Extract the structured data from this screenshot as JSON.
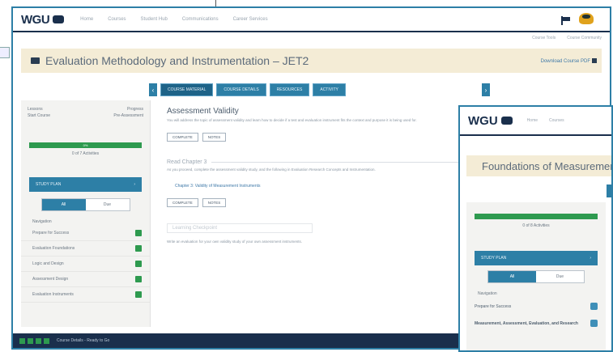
{
  "main": {
    "logo": "WGU",
    "nav": [
      "Home",
      "Courses",
      "Student Hub",
      "Communications",
      "Career Services"
    ],
    "subnav": [
      "Course Tools",
      "Course Community"
    ],
    "title": "Evaluation Methodology and Instrumentation – JET2",
    "title_right": "Download Course PDF",
    "tabs": [
      "COURSE MATERIAL",
      "COURSE DETAILS",
      "RESOURCES",
      "ACTIVITY"
    ],
    "sidebar": {
      "stat_left_label": "Lessons",
      "stat_left_value": "Start Course",
      "stat_right_label": "Progress",
      "stat_right_value": "Pre-Assessment",
      "progress_pct": 100,
      "progress_label": "0%",
      "progress_sub": "0 of 7 Activities",
      "study_plan": "STUDY PLAN",
      "toggle_on": "All",
      "toggle_off": "Due",
      "nav_head": "Navigation",
      "items": [
        "Prepare for Success",
        "Evaluation Foundations",
        "Logic and Design",
        "Assessment Design",
        "Evaluation Instruments"
      ]
    },
    "content": {
      "heading": "Assessment Validity",
      "paragraph": "You will address the topic of assessment validity and learn how to decide if a test and evaluation instrument fits the context and purpose it is being used for.",
      "btn_complete": "COMPLETE",
      "btn_notes": "NOTES",
      "section_heading": "Read Chapter 3",
      "section_paragraph": "As you proceed, complete the assessment validity study, and the following in Evaluation Research Concepts and Instrumentation.",
      "link": "Chapter 3: Validity of Measurement Instruments",
      "btn_complete2": "COMPLETE",
      "btn_notes2": "NOTES",
      "boxed_heading": "Learning Checkpoint",
      "footer_paragraph": "Write an evaluation for your own validity study of your own assessment instruments."
    },
    "bottombar_text": "Course Details - Ready to Go"
  },
  "overlay": {
    "logo": "WGU",
    "nav": [
      "Home",
      "Courses"
    ],
    "title": "Foundations of Measurement",
    "progress_sub": "0 of 8 Activities",
    "study_plan": "STUDY PLAN",
    "toggle_on": "All",
    "toggle_off": "Due",
    "nav_head": "Navigation",
    "items": [
      "Prepare for Success",
      "Measurement, Assessment, Evaluation, and Research"
    ]
  },
  "colors": {
    "navy": "#1a2f4c",
    "teal": "#2d7fa6",
    "green": "#2e9a4f",
    "cream": "#f4ecd6"
  }
}
